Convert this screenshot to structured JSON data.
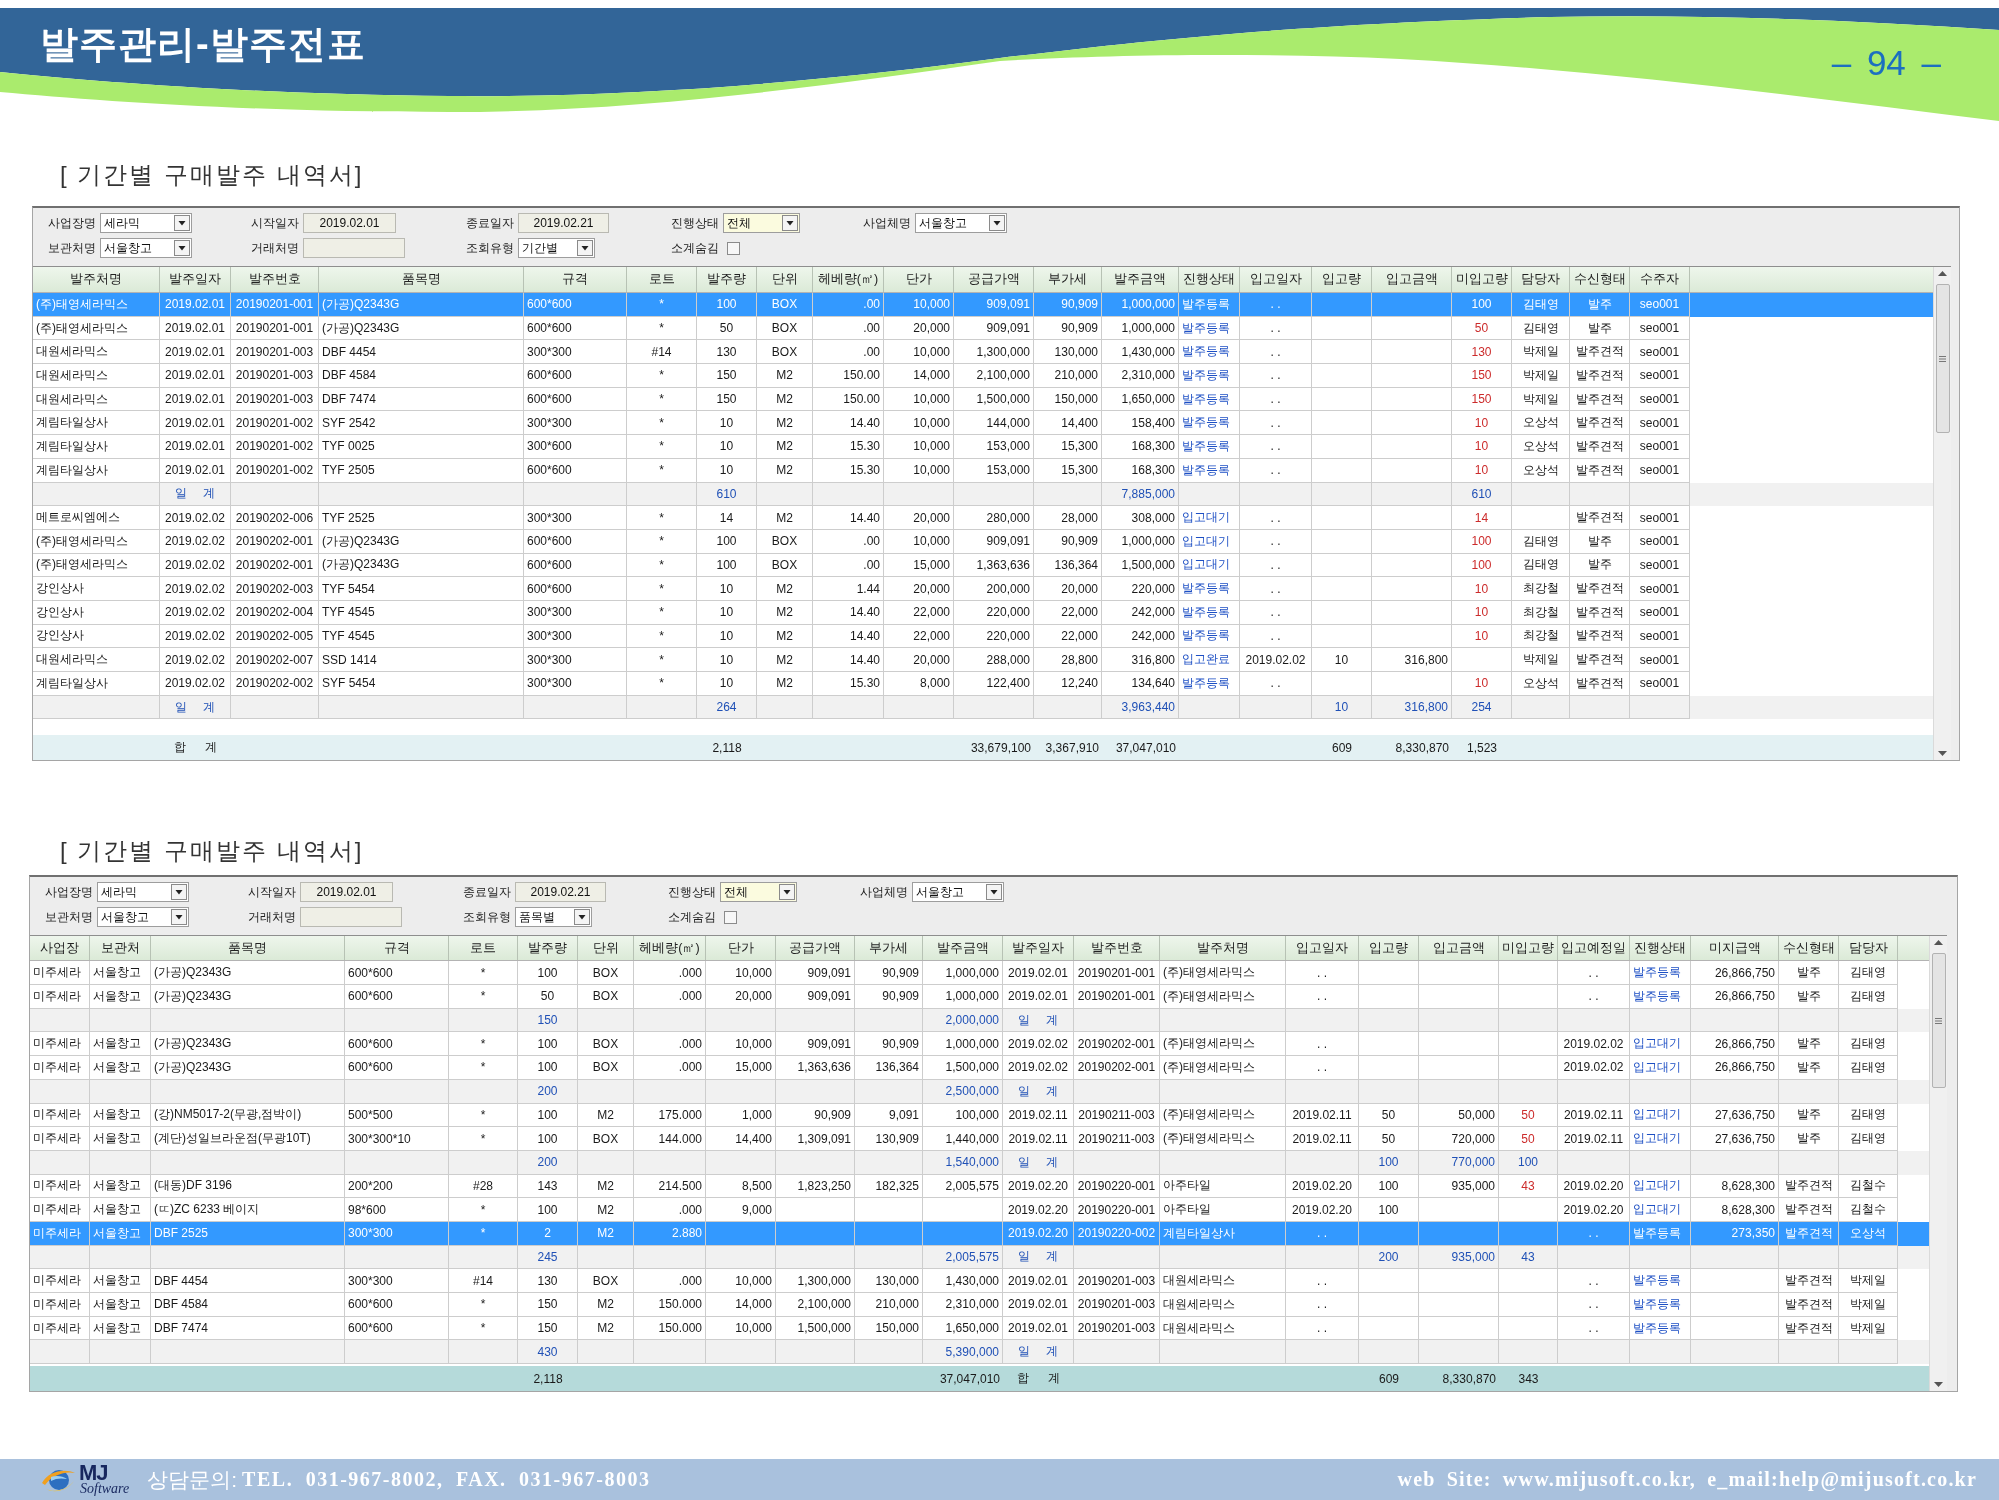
{
  "header": {
    "title": "발주관리-발주전표",
    "page_number": "– 94 –"
  },
  "reports": [
    {
      "title": "[ 기간별 구매발주 내역서]",
      "filter_rows": [
        {
          "fields": [
            {
              "kind": "select",
              "label": "사업장명",
              "value": "세라믹"
            },
            {
              "kind": "date",
              "label": "시작일자",
              "value": "2019.02.01"
            },
            {
              "kind": "date",
              "label": "종료일자",
              "value": "2019.02.21"
            },
            {
              "kind": "select",
              "label": "진행상태",
              "value": "전체"
            },
            {
              "kind": "select",
              "label": "사업체명",
              "value": "서울창고"
            }
          ]
        },
        {
          "fields": [
            {
              "kind": "select",
              "label": "보관처명",
              "value": "서울창고"
            },
            {
              "kind": "text",
              "label": "거래처명"
            },
            {
              "kind": "select",
              "label": "조회유형",
              "value": "기간별"
            },
            {
              "kind": "checkbox",
              "label": "소계숨김",
              "checked": false
            }
          ]
        }
      ],
      "table": {
        "columns": [
          "발주처명",
          "발주일자",
          "발주번호",
          "품목명",
          "규격",
          "로트",
          "발주량",
          "단위",
          "헤베량(㎡)",
          "단가",
          "공급가액",
          "부가세",
          "발주금액",
          "진행상태",
          "입고일자",
          "입고량",
          "입고금액",
          "미입고량",
          "담당자",
          "수신형태",
          "수주자"
        ],
        "rows": [
          {
            "kind": "data",
            "selected": true,
            "supplier": "(주)태영세라믹스",
            "order_date": "2019.02.01",
            "order_no": "20190201-001",
            "item": "(가공)Q2343G",
            "spec": "600*600",
            "lot": "*",
            "qty": "100",
            "unit": "BOX",
            "area": ".00",
            "price": "10,000",
            "supply": "909,091",
            "vat": "90,909",
            "amount": "1,000,000",
            "status": "발주등록",
            "in_date": ". .",
            "pending": "100",
            "manager": "김태영",
            "receive_type": "발주",
            "recipient": "seo001"
          },
          {
            "kind": "data",
            "selected": false,
            "supplier": "(주)태영세라믹스",
            "order_date": "2019.02.01",
            "order_no": "20190201-001",
            "item": "(가공)Q2343G",
            "spec": "600*600",
            "lot": "*",
            "qty": "50",
            "unit": "BOX",
            "area": ".00",
            "price": "20,000",
            "supply": "909,091",
            "vat": "90,909",
            "amount": "1,000,000",
            "status": "발주등록",
            "in_date": ". .",
            "pending": "50",
            "manager": "김태영",
            "receive_type": "발주",
            "recipient": "seo001"
          },
          {
            "kind": "data",
            "selected": false,
            "supplier": "대원세라믹스",
            "order_date": "2019.02.01",
            "order_no": "20190201-003",
            "item": "DBF 4454",
            "spec": "300*300",
            "lot": "#14",
            "qty": "130",
            "unit": "BOX",
            "area": ".00",
            "price": "10,000",
            "supply": "1,300,000",
            "vat": "130,000",
            "amount": "1,430,000",
            "status": "발주등록",
            "in_date": ". .",
            "pending": "130",
            "manager": "박제일",
            "receive_type": "발주견적",
            "recipient": "seo001"
          },
          {
            "kind": "data",
            "selected": false,
            "supplier": "대원세라믹스",
            "order_date": "2019.02.01",
            "order_no": "20190201-003",
            "item": "DBF 4584",
            "spec": "600*600",
            "lot": "*",
            "qty": "150",
            "unit": "M2",
            "area": "150.00",
            "price": "14,000",
            "supply": "2,100,000",
            "vat": "210,000",
            "amount": "2,310,000",
            "status": "발주등록",
            "in_date": ". .",
            "pending": "150",
            "manager": "박제일",
            "receive_type": "발주견적",
            "recipient": "seo001"
          },
          {
            "kind": "data",
            "selected": false,
            "supplier": "대원세라믹스",
            "order_date": "2019.02.01",
            "order_no": "20190201-003",
            "item": "DBF 7474",
            "spec": "600*600",
            "lot": "*",
            "qty": "150",
            "unit": "M2",
            "area": "150.00",
            "price": "10,000",
            "supply": "1,500,000",
            "vat": "150,000",
            "amount": "1,650,000",
            "status": "발주등록",
            "in_date": ". .",
            "pending": "150",
            "manager": "박제일",
            "receive_type": "발주견적",
            "recipient": "seo001"
          },
          {
            "kind": "data",
            "selected": false,
            "supplier": "계림타일상사",
            "order_date": "2019.02.01",
            "order_no": "20190201-002",
            "item": "SYF 2542",
            "spec": "300*300",
            "lot": "*",
            "qty": "10",
            "unit": "M2",
            "area": "14.40",
            "price": "10,000",
            "supply": "144,000",
            "vat": "14,400",
            "amount": "158,400",
            "status": "발주등록",
            "in_date": ". .",
            "pending": "10",
            "manager": "오상석",
            "receive_type": "발주견적",
            "recipient": "seo001"
          },
          {
            "kind": "data",
            "selected": false,
            "supplier": "계림타일상사",
            "order_date": "2019.02.01",
            "order_no": "20190201-002",
            "item": "TYF 0025",
            "spec": "300*600",
            "lot": "*",
            "qty": "10",
            "unit": "M2",
            "area": "15.30",
            "price": "10,000",
            "supply": "153,000",
            "vat": "15,300",
            "amount": "168,300",
            "status": "발주등록",
            "in_date": ". .",
            "pending": "10",
            "manager": "오상석",
            "receive_type": "발주견적",
            "recipient": "seo001"
          },
          {
            "kind": "data",
            "selected": false,
            "supplier": "계림타일상사",
            "order_date": "2019.02.01",
            "order_no": "20190201-002",
            "item": "TYF 2505",
            "spec": "600*600",
            "lot": "*",
            "qty": "10",
            "unit": "M2",
            "area": "15.30",
            "price": "10,000",
            "supply": "153,000",
            "vat": "15,300",
            "amount": "168,300",
            "status": "발주등록",
            "in_date": ". .",
            "pending": "10",
            "manager": "오상석",
            "receive_type": "발주견적",
            "recipient": "seo001"
          },
          {
            "kind": "subtotal",
            "selected": false,
            "order_date": "일 계",
            "qty": "610",
            "amount": "7,885,000",
            "pending": "610"
          },
          {
            "kind": "data",
            "selected": false,
            "supplier": "메트로씨엠에스",
            "order_date": "2019.02.02",
            "order_no": "20190202-006",
            "item": "TYF 2525",
            "spec": "300*300",
            "lot": "*",
            "qty": "14",
            "unit": "M2",
            "area": "14.40",
            "price": "20,000",
            "supply": "280,000",
            "vat": "28,000",
            "amount": "308,000",
            "status": "입고대기",
            "in_date": ". .",
            "pending": "14",
            "receive_type": "발주견적",
            "recipient": "seo001"
          },
          {
            "kind": "data",
            "selected": false,
            "supplier": "(주)태영세라믹스",
            "order_date": "2019.02.02",
            "order_no": "20190202-001",
            "item": "(가공)Q2343G",
            "spec": "600*600",
            "lot": "*",
            "qty": "100",
            "unit": "BOX",
            "area": ".00",
            "price": "10,000",
            "supply": "909,091",
            "vat": "90,909",
            "amount": "1,000,000",
            "status": "입고대기",
            "in_date": ". .",
            "pending": "100",
            "manager": "김태영",
            "receive_type": "발주",
            "recipient": "seo001"
          },
          {
            "kind": "data",
            "selected": false,
            "supplier": "(주)태영세라믹스",
            "order_date": "2019.02.02",
            "order_no": "20190202-001",
            "item": "(가공)Q2343G",
            "spec": "600*600",
            "lot": "*",
            "qty": "100",
            "unit": "BOX",
            "area": ".00",
            "price": "15,000",
            "supply": "1,363,636",
            "vat": "136,364",
            "amount": "1,500,000",
            "status": "입고대기",
            "in_date": ". .",
            "pending": "100",
            "manager": "김태영",
            "receive_type": "발주",
            "recipient": "seo001"
          },
          {
            "kind": "data",
            "selected": false,
            "supplier": "강인상사",
            "order_date": "2019.02.02",
            "order_no": "20190202-003",
            "item": "TYF 5454",
            "spec": "600*600",
            "lot": "*",
            "qty": "10",
            "unit": "M2",
            "area": "1.44",
            "price": "20,000",
            "supply": "200,000",
            "vat": "20,000",
            "amount": "220,000",
            "status": "발주등록",
            "in_date": ". .",
            "pending": "10",
            "manager": "최강철",
            "receive_type": "발주견적",
            "recipient": "seo001"
          },
          {
            "kind": "data",
            "selected": false,
            "supplier": "강인상사",
            "order_date": "2019.02.02",
            "order_no": "20190202-004",
            "item": "TYF 4545",
            "spec": "300*300",
            "lot": "*",
            "qty": "10",
            "unit": "M2",
            "area": "14.40",
            "price": "22,000",
            "supply": "220,000",
            "vat": "22,000",
            "amount": "242,000",
            "status": "발주등록",
            "in_date": ". .",
            "pending": "10",
            "manager": "최강철",
            "receive_type": "발주견적",
            "recipient": "seo001"
          },
          {
            "kind": "data",
            "selected": false,
            "supplier": "강인상사",
            "order_date": "2019.02.02",
            "order_no": "20190202-005",
            "item": "TYF 4545",
            "spec": "300*300",
            "lot": "*",
            "qty": "10",
            "unit": "M2",
            "area": "14.40",
            "price": "22,000",
            "supply": "220,000",
            "vat": "22,000",
            "amount": "242,000",
            "status": "발주등록",
            "in_date": ". .",
            "pending": "10",
            "manager": "최강철",
            "receive_type": "발주견적",
            "recipient": "seo001"
          },
          {
            "kind": "data",
            "selected": false,
            "supplier": "대원세라믹스",
            "order_date": "2019.02.02",
            "order_no": "20190202-007",
            "item": "SSD 1414",
            "spec": "300*300",
            "lot": "*",
            "qty": "10",
            "unit": "M2",
            "area": "14.40",
            "price": "20,000",
            "supply": "288,000",
            "vat": "28,800",
            "amount": "316,800",
            "status": "입고완료",
            "in_date": "2019.02.02",
            "in_qty": "10",
            "in_amount": "316,800",
            "manager": "박제일",
            "receive_type": "발주견적",
            "recipient": "seo001"
          },
          {
            "kind": "data",
            "selected": false,
            "supplier": "계림타일상사",
            "order_date": "2019.02.02",
            "order_no": "20190202-002",
            "item": "SYF 5454",
            "spec": "300*300",
            "lot": "*",
            "qty": "10",
            "unit": "M2",
            "area": "15.30",
            "price": "8,000",
            "supply": "122,400",
            "vat": "12,240",
            "amount": "134,640",
            "status": "발주등록",
            "in_date": ". .",
            "pending": "10",
            "manager": "오상석",
            "receive_type": "발주견적",
            "recipient": "seo001"
          },
          {
            "kind": "subtotal",
            "selected": false,
            "order_date": "일 계",
            "qty": "264",
            "amount": "3,963,440",
            "in_qty": "10",
            "in_amount": "316,800",
            "pending": "254"
          }
        ],
        "total": {
          "order_date": "합 계",
          "qty": "2,118",
          "supply": "33,679,100",
          "vat": "3,367,910",
          "amount": "37,047,010",
          "in_qty": "609",
          "in_amount": "8,330,870",
          "pending": "1,523"
        }
      }
    },
    {
      "title": "[ 기간별 구매발주 내역서]",
      "filter_rows": [
        {
          "fields": [
            {
              "kind": "select",
              "label": "사업장명",
              "value": "세라믹"
            },
            {
              "kind": "date",
              "label": "시작일자",
              "value": "2019.02.01"
            },
            {
              "kind": "date",
              "label": "종료일자",
              "value": "2019.02.21"
            },
            {
              "kind": "select",
              "label": "진행상태",
              "value": "전체"
            },
            {
              "kind": "select",
              "label": "사업체명",
              "value": "서울창고"
            }
          ]
        },
        {
          "fields": [
            {
              "kind": "select",
              "label": "보관처명",
              "value": "서울창고"
            },
            {
              "kind": "text",
              "label": "거래처명"
            },
            {
              "kind": "select",
              "label": "조회유형",
              "value": "품목별"
            },
            {
              "kind": "checkbox",
              "label": "소계숨김",
              "checked": false
            }
          ]
        }
      ],
      "table": {
        "columns": [
          "사업장",
          "보관처",
          "품목명",
          "규격",
          "로트",
          "발주량",
          "단위",
          "헤베량(㎡)",
          "단가",
          "공급가액",
          "부가세",
          "발주금액",
          "발주일자",
          "발주번호",
          "발주처명",
          "입고일자",
          "입고량",
          "입고금액",
          "미입고량",
          "입고예정일",
          "진행상태",
          "미지급액",
          "수신형태",
          "담당자"
        ],
        "rows": [
          {
            "kind": "data",
            "selected": false,
            "site": "미주세라",
            "storage": "서울창고",
            "item": "(가공)Q2343G",
            "spec": "600*600",
            "lot": "*",
            "qty": "100",
            "unit": "BOX",
            "area": ".000",
            "price": "10,000",
            "supply": "909,091",
            "vat": "90,909",
            "amount": "1,000,000",
            "order_date": "2019.02.01",
            "order_no": "20190201-001",
            "supplier": "(주)태영세라믹스",
            "in_date": ". .",
            "due_date": ". .",
            "status": "발주등록",
            "unpaid": "26,866,750",
            "receive_type": "발주",
            "manager": "김태영"
          },
          {
            "kind": "data",
            "selected": false,
            "site": "미주세라",
            "storage": "서울창고",
            "item": "(가공)Q2343G",
            "spec": "600*600",
            "lot": "*",
            "qty": "50",
            "unit": "BOX",
            "area": ".000",
            "price": "20,000",
            "supply": "909,091",
            "vat": "90,909",
            "amount": "1,000,000",
            "order_date": "2019.02.01",
            "order_no": "20190201-001",
            "supplier": "(주)태영세라믹스",
            "in_date": ". .",
            "due_date": ". .",
            "status": "발주등록",
            "unpaid": "26,866,750",
            "receive_type": "발주",
            "manager": "김태영"
          },
          {
            "kind": "subtotal",
            "selected": false,
            "qty": "150",
            "amount": "2,000,000",
            "order_date": "일 계"
          },
          {
            "kind": "data",
            "selected": false,
            "site": "미주세라",
            "storage": "서울창고",
            "item": "(가공)Q2343G",
            "spec": "600*600",
            "lot": "*",
            "qty": "100",
            "unit": "BOX",
            "area": ".000",
            "price": "10,000",
            "supply": "909,091",
            "vat": "90,909",
            "amount": "1,000,000",
            "order_date": "2019.02.02",
            "order_no": "20190202-001",
            "supplier": "(주)태영세라믹스",
            "in_date": ". .",
            "due_date": "2019.02.02",
            "status": "입고대기",
            "unpaid": "26,866,750",
            "receive_type": "발주",
            "manager": "김태영"
          },
          {
            "kind": "data",
            "selected": false,
            "site": "미주세라",
            "storage": "서울창고",
            "item": "(가공)Q2343G",
            "spec": "600*600",
            "lot": "*",
            "qty": "100",
            "unit": "BOX",
            "area": ".000",
            "price": "15,000",
            "supply": "1,363,636",
            "vat": "136,364",
            "amount": "1,500,000",
            "order_date": "2019.02.02",
            "order_no": "20190202-001",
            "supplier": "(주)태영세라믹스",
            "in_date": ". .",
            "due_date": "2019.02.02",
            "status": "입고대기",
            "unpaid": "26,866,750",
            "receive_type": "발주",
            "manager": "김태영"
          },
          {
            "kind": "subtotal",
            "selected": false,
            "qty": "200",
            "amount": "2,500,000",
            "order_date": "일 계"
          },
          {
            "kind": "data",
            "selected": false,
            "site": "미주세라",
            "storage": "서울창고",
            "item": "(강)NM5017-2(무광,점박이)",
            "spec": "500*500",
            "lot": "*",
            "qty": "100",
            "unit": "M2",
            "area": "175.000",
            "price": "1,000",
            "supply": "90,909",
            "vat": "9,091",
            "amount": "100,000",
            "order_date": "2019.02.11",
            "order_no": "20190211-003",
            "supplier": "(주)태영세라믹스",
            "in_date": "2019.02.11",
            "in_qty": "50",
            "in_amount": "50,000",
            "pending": "50",
            "due_date": "2019.02.11",
            "status": "입고대기",
            "unpaid": "27,636,750",
            "receive_type": "발주",
            "manager": "김태영"
          },
          {
            "kind": "data",
            "selected": false,
            "site": "미주세라",
            "storage": "서울창고",
            "item": "(계단)성일브라운점(무광10T)",
            "spec": "300*300*10",
            "lot": "*",
            "qty": "100",
            "unit": "BOX",
            "area": "144.000",
            "price": "14,400",
            "supply": "1,309,091",
            "vat": "130,909",
            "amount": "1,440,000",
            "order_date": "2019.02.11",
            "order_no": "20190211-003",
            "supplier": "(주)태영세라믹스",
            "in_date": "2019.02.11",
            "in_qty": "50",
            "in_amount": "720,000",
            "pending": "50",
            "due_date": "2019.02.11",
            "status": "입고대기",
            "unpaid": "27,636,750",
            "receive_type": "발주",
            "manager": "김태영"
          },
          {
            "kind": "subtotal",
            "selected": false,
            "qty": "200",
            "amount": "1,540,000",
            "order_date": "일 계",
            "in_qty": "100",
            "in_amount": "770,000",
            "pending": "100"
          },
          {
            "kind": "data",
            "selected": false,
            "site": "미주세라",
            "storage": "서울창고",
            "item": "(대동)DF 3196",
            "spec": "200*200",
            "lot": "#28",
            "qty": "143",
            "unit": "M2",
            "area": "214.500",
            "price": "8,500",
            "supply": "1,823,250",
            "vat": "182,325",
            "amount": "2,005,575",
            "order_date": "2019.02.20",
            "order_no": "20190220-001",
            "supplier": "아주타일",
            "in_date": "2019.02.20",
            "in_qty": "100",
            "in_amount": "935,000",
            "pending": "43",
            "due_date": "2019.02.20",
            "status": "입고대기",
            "unpaid": "8,628,300",
            "receive_type": "발주견적",
            "manager": "김철수"
          },
          {
            "kind": "data",
            "selected": false,
            "site": "미주세라",
            "storage": "서울창고",
            "item": "(ㄸ)ZC 6233 베이지",
            "spec": "98*600",
            "lot": "*",
            "qty": "100",
            "unit": "M2",
            "area": ".000",
            "price": "9,000",
            "order_date": "2019.02.20",
            "order_no": "20190220-001",
            "supplier": "아주타일",
            "in_date": "2019.02.20",
            "in_qty": "100",
            "due_date": "2019.02.20",
            "status": "입고대기",
            "unpaid": "8,628,300",
            "receive_type": "발주견적",
            "manager": "김철수"
          },
          {
            "kind": "data",
            "selected": true,
            "site": "미주세라",
            "storage": "서울창고",
            "item": "DBF 2525",
            "spec": "300*300",
            "lot": "*",
            "qty": "2",
            "unit": "M2",
            "area": "2.880",
            "order_date": "2019.02.20",
            "order_no": "20190220-002",
            "supplier": "계림타일상사",
            "in_date": ". .",
            "due_date": ". .",
            "status": "발주등록",
            "unpaid": "273,350",
            "receive_type": "발주견적",
            "manager": "오상석"
          },
          {
            "kind": "subtotal",
            "selected": false,
            "qty": "245",
            "amount": "2,005,575",
            "order_date": "일 계",
            "in_qty": "200",
            "in_amount": "935,000",
            "pending": "43"
          },
          {
            "kind": "data",
            "selected": false,
            "site": "미주세라",
            "storage": "서울창고",
            "item": "DBF 4454",
            "spec": "300*300",
            "lot": "#14",
            "qty": "130",
            "unit": "BOX",
            "area": ".000",
            "price": "10,000",
            "supply": "1,300,000",
            "vat": "130,000",
            "amount": "1,430,000",
            "order_date": "2019.02.01",
            "order_no": "20190201-003",
            "supplier": "대원세라믹스",
            "in_date": ". .",
            "due_date": ". .",
            "status": "발주등록",
            "receive_type": "발주견적",
            "manager": "박제일"
          },
          {
            "kind": "data",
            "selected": false,
            "site": "미주세라",
            "storage": "서울창고",
            "item": "DBF 4584",
            "spec": "600*600",
            "lot": "*",
            "qty": "150",
            "unit": "M2",
            "area": "150.000",
            "price": "14,000",
            "supply": "2,100,000",
            "vat": "210,000",
            "amount": "2,310,000",
            "order_date": "2019.02.01",
            "order_no": "20190201-003",
            "supplier": "대원세라믹스",
            "in_date": ". .",
            "due_date": ". .",
            "status": "발주등록",
            "receive_type": "발주견적",
            "manager": "박제일"
          },
          {
            "kind": "data",
            "selected": false,
            "site": "미주세라",
            "storage": "서울창고",
            "item": "DBF 7474",
            "spec": "600*600",
            "lot": "*",
            "qty": "150",
            "unit": "M2",
            "area": "150.000",
            "price": "10,000",
            "supply": "1,500,000",
            "vat": "150,000",
            "amount": "1,650,000",
            "order_date": "2019.02.01",
            "order_no": "20190201-003",
            "supplier": "대원세라믹스",
            "in_date": ". .",
            "due_date": ". .",
            "status": "발주등록",
            "receive_type": "발주견적",
            "manager": "박제일"
          },
          {
            "kind": "subtotal",
            "selected": false,
            "qty": "430",
            "amount": "5,390,000",
            "order_date": "일 계"
          }
        ],
        "total": {
          "qty": "2,118",
          "amount": "37,047,010",
          "order_date": "합 계",
          "in_qty": "609",
          "in_amount": "8,330,870",
          "pending": "343"
        }
      }
    }
  ],
  "footer": {
    "logo": {
      "name": "MJ",
      "tagline": "Software"
    },
    "contact_label": "상담문의:",
    "contact": "TEL. 031-967-8002, FAX. 031-967-8003",
    "web": "web Site: www.mijusoft.co.kr, e_mail:help@mijusoft.co.kr"
  }
}
